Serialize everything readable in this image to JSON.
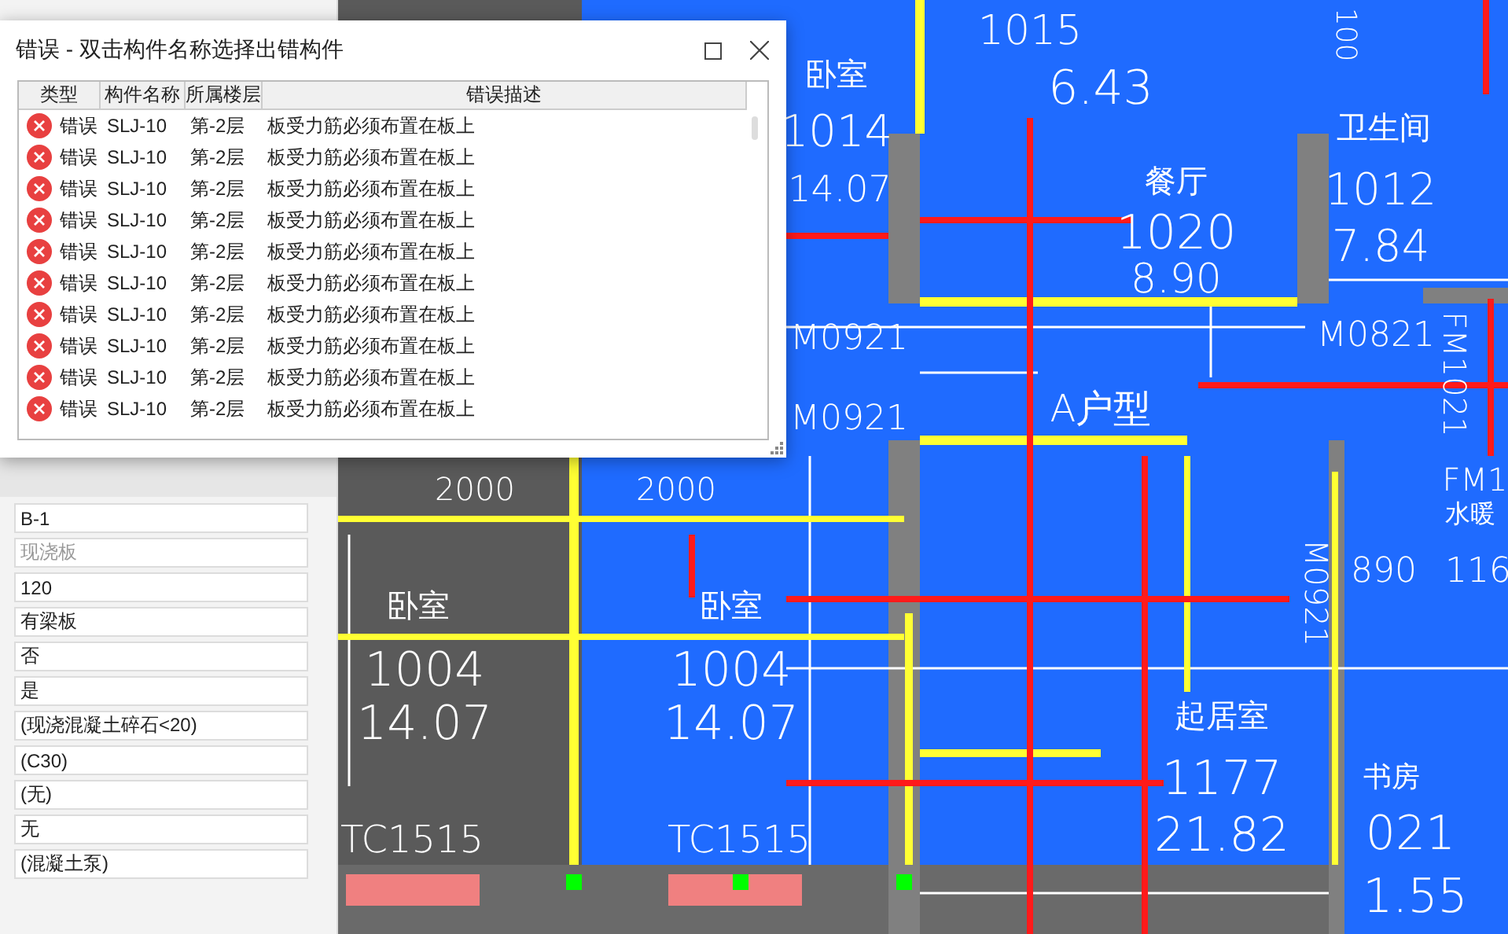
{
  "dialog": {
    "title": "错误 - 双击构件名称选择出错构件",
    "columns": [
      "类型",
      "构件名称",
      "所属楼层",
      "错误描述"
    ],
    "rows": [
      {
        "kind": "error",
        "type": "错误",
        "name": "SLJ-10",
        "floor": "第-2层",
        "description": "板受力筋必须布置在板上"
      },
      {
        "kind": "error",
        "type": "错误",
        "name": "SLJ-10",
        "floor": "第-2层",
        "description": "板受力筋必须布置在板上"
      },
      {
        "kind": "error",
        "type": "错误",
        "name": "SLJ-10",
        "floor": "第-2层",
        "description": "板受力筋必须布置在板上"
      },
      {
        "kind": "error",
        "type": "错误",
        "name": "SLJ-10",
        "floor": "第-2层",
        "description": "板受力筋必须布置在板上"
      },
      {
        "kind": "error",
        "type": "错误",
        "name": "SLJ-10",
        "floor": "第-2层",
        "description": "板受力筋必须布置在板上"
      },
      {
        "kind": "error",
        "type": "错误",
        "name": "SLJ-10",
        "floor": "第-2层",
        "description": "板受力筋必须布置在板上"
      },
      {
        "kind": "error",
        "type": "错误",
        "name": "SLJ-10",
        "floor": "第-2层",
        "description": "板受力筋必须布置在板上"
      },
      {
        "kind": "error",
        "type": "错误",
        "name": "SLJ-10",
        "floor": "第-2层",
        "description": "板受力筋必须布置在板上"
      },
      {
        "kind": "error",
        "type": "错误",
        "name": "SLJ-10",
        "floor": "第-2层",
        "description": "板受力筋必须布置在板上"
      },
      {
        "kind": "error",
        "type": "错误",
        "name": "SLJ-10",
        "floor": "第-2层",
        "description": "板受力筋必须布置在板上"
      }
    ]
  },
  "properties": [
    {
      "value": "B-1",
      "disabled": false
    },
    {
      "value": "现浇板",
      "disabled": true
    },
    {
      "value": "120",
      "disabled": false
    },
    {
      "value": "有梁板",
      "disabled": false
    },
    {
      "value": "否",
      "disabled": false
    },
    {
      "value": "是",
      "disabled": false
    },
    {
      "value": "(现浇混凝土碎石<20)",
      "disabled": false
    },
    {
      "value": "(C30)",
      "disabled": false
    },
    {
      "value": "(无)",
      "disabled": false
    },
    {
      "value": "无",
      "disabled": false
    },
    {
      "value": "(混凝土泵)",
      "disabled": false
    }
  ],
  "canvas_labels": [
    "1015",
    "卧室",
    "6.43",
    "1014",
    "14.07",
    "餐厅",
    "1020",
    "8.90",
    "卫生间",
    "1012",
    "7.84",
    "100",
    "M0921",
    "M0921",
    "A户型",
    "M0821",
    "FM1021",
    "2000",
    "2000",
    "FM1",
    "水暖",
    "M0921",
    "890",
    "116",
    "卧室",
    "1004",
    "14.07",
    "卧室",
    "1004",
    "14.07",
    "TC1515",
    "TC1515",
    "起居室",
    "1177",
    "21.82",
    "书房",
    "021",
    "1.55"
  ]
}
